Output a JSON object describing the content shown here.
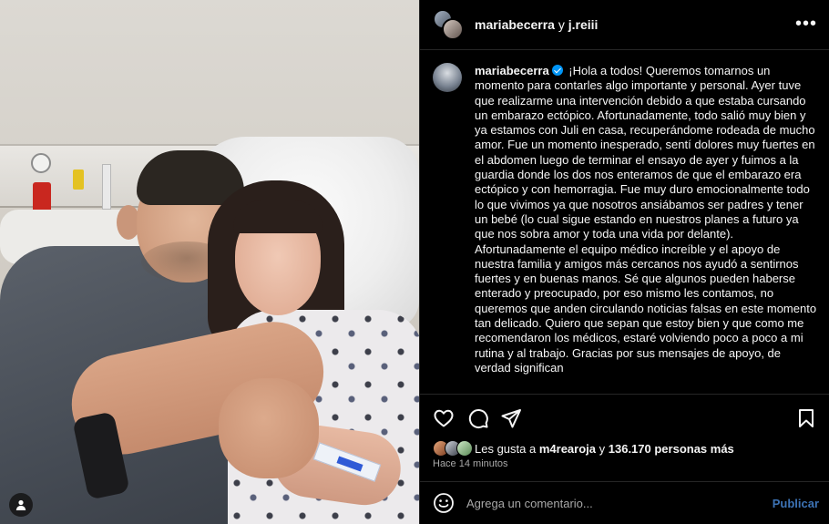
{
  "header": {
    "user1": "mariabecerra",
    "joiner": "y",
    "user2": "j.reiii",
    "more_icon": "more-horizontal-icon",
    "more_label": "•••"
  },
  "caption": {
    "username": "mariabecerra",
    "verified": true,
    "text": "¡Hola a todos! Queremos tomarnos un momento para contarles algo importante y personal. Ayer tuve que realizarme una intervención debido a que estaba cursando un embarazo ectópico. Afortunadamente, todo salió muy bien y ya estamos con Juli en casa, recuperándome rodeada de mucho amor. Fue un momento inesperado, sentí dolores muy fuertes en el abdomen luego de terminar el ensayo de ayer y fuimos a la guardia donde los dos nos enteramos de que el embarazo era ectópico y con hemorragia. Fue muy duro emocionalmente todo lo que vivimos ya que nosotros ansiábamos ser padres y tener un bebé (lo cual sigue estando en nuestros planes a futuro ya que nos sobra amor y toda una vida por delante). Afortunadamente el equipo médico increíble y el apoyo de nuestra familia y amigos más cercanos nos ayudó a sentirnos fuertes y en buenas manos. Sé que algunos pueden haberse enterado y preocupado, por eso mismo les contamos, no queremos que anden circulando noticias falsas en este momento tan delicado. Quiero que sepan que estoy bien y que como me recomendaron los médicos, estaré volviendo poco a poco a mi rutina y al trabajo. Gracias por sus mensajes de apoyo, de verdad significan"
  },
  "actions": {
    "like_icon": "heart-icon",
    "comment_icon": "comment-icon",
    "share_icon": "send-icon",
    "save_icon": "bookmark-icon"
  },
  "likes": {
    "prefix": "Les gusta a",
    "first_user": "m4rearoja",
    "middle": "y",
    "count": "136.170 personas más"
  },
  "timestamp": "Hace 14 minutos",
  "comment": {
    "placeholder": "Agrega un comentario...",
    "publish_label": "Publicar",
    "emoji_icon": "emoji-icon"
  },
  "photo": {
    "tag_icon": "user-tag-icon"
  },
  "colors": {
    "background": "#000000",
    "text": "#f5f5f5",
    "secondary_text": "#a8a8a8",
    "verified": "#0095f6",
    "publish": "#3d73b5",
    "divider": "#262626"
  }
}
